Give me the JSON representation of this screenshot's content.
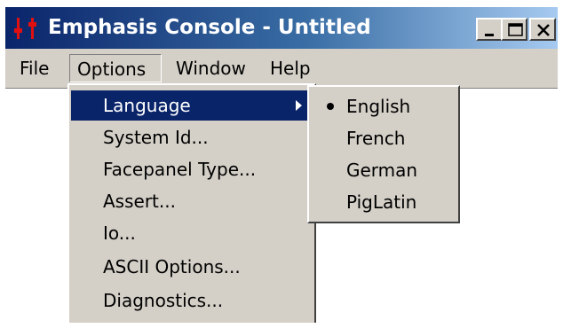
{
  "window": {
    "title": "Emphasis Console - Untitled",
    "icons": {
      "app": "app-sliders-icon",
      "minimize": "minimize-icon",
      "maximize": "maximize-icon",
      "close": "close-icon"
    },
    "colors": {
      "titlebar_start": "#0a246a",
      "titlebar_end": "#a6caf0",
      "menu_bg": "#d4d0c8",
      "highlight": "#0a246a",
      "app_icon_red": "#e01010"
    }
  },
  "menubar": {
    "items": [
      {
        "label": "File"
      },
      {
        "label": "Options"
      },
      {
        "label": "Window"
      },
      {
        "label": "Help"
      }
    ]
  },
  "options_menu": {
    "items": [
      {
        "label": "Language",
        "has_submenu": true
      },
      {
        "label": "System Id..."
      },
      {
        "label": "Facepanel Type..."
      },
      {
        "label": "Assert..."
      },
      {
        "label": "Io..."
      },
      {
        "label": "ASCII Options..."
      },
      {
        "label": "Diagnostics..."
      }
    ],
    "highlighted": "Language"
  },
  "language_submenu": {
    "items": [
      {
        "label": "English"
      },
      {
        "label": "French"
      },
      {
        "label": "German"
      },
      {
        "label": "PigLatin"
      }
    ],
    "selected": "English"
  }
}
